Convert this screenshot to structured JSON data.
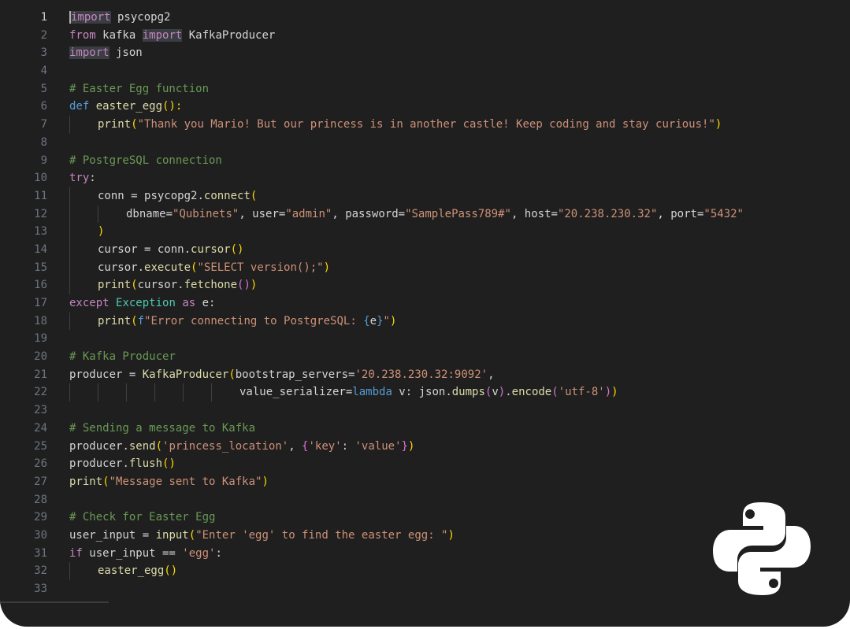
{
  "editor": {
    "active_line": 1,
    "lines": [
      {
        "n": "1",
        "tokens": [
          {
            "t": "import",
            "c": "kw",
            "hl": true
          },
          {
            "t": " psycopg2",
            "c": "txt"
          }
        ]
      },
      {
        "n": "2",
        "tokens": [
          {
            "t": "from",
            "c": "kw"
          },
          {
            "t": " kafka ",
            "c": "txt"
          },
          {
            "t": "import",
            "c": "kw",
            "hl": true
          },
          {
            "t": " KafkaProducer",
            "c": "txt"
          }
        ]
      },
      {
        "n": "3",
        "tokens": [
          {
            "t": "import",
            "c": "kw",
            "hl": true
          },
          {
            "t": " json",
            "c": "txt"
          }
        ]
      },
      {
        "n": "4",
        "tokens": []
      },
      {
        "n": "5",
        "tokens": [
          {
            "t": "# Easter Egg function",
            "c": "cmt"
          }
        ]
      },
      {
        "n": "6",
        "tokens": [
          {
            "t": "def",
            "c": "def"
          },
          {
            "t": " ",
            "c": "txt"
          },
          {
            "t": "easter_egg",
            "c": "fn"
          },
          {
            "t": "():",
            "c": "paren"
          }
        ]
      },
      {
        "n": "7",
        "indent": 1,
        "tokens": [
          {
            "t": "print",
            "c": "fn"
          },
          {
            "t": "(",
            "c": "paren"
          },
          {
            "t": "\"Thank you Mario! But our princess is in another castle! Keep coding and stay curious!\"",
            "c": "str"
          },
          {
            "t": ")",
            "c": "paren"
          }
        ]
      },
      {
        "n": "8",
        "tokens": []
      },
      {
        "n": "9",
        "tokens": [
          {
            "t": "# PostgreSQL connection",
            "c": "cmt"
          }
        ]
      },
      {
        "n": "10",
        "tokens": [
          {
            "t": "try",
            "c": "kw"
          },
          {
            "t": ":",
            "c": "txt"
          }
        ]
      },
      {
        "n": "11",
        "indent": 1,
        "tokens": [
          {
            "t": "conn",
            "c": "txt"
          },
          {
            "t": " = ",
            "c": "txt"
          },
          {
            "t": "psycopg2",
            "c": "txt"
          },
          {
            "t": ".",
            "c": "txt"
          },
          {
            "t": "connect",
            "c": "fn"
          },
          {
            "t": "(",
            "c": "paren"
          }
        ]
      },
      {
        "n": "12",
        "indent": 2,
        "tokens": [
          {
            "t": "dbname",
            "c": "txt"
          },
          {
            "t": "=",
            "c": "txt"
          },
          {
            "t": "\"Qubinets\"",
            "c": "str"
          },
          {
            "t": ", ",
            "c": "txt"
          },
          {
            "t": "user",
            "c": "txt"
          },
          {
            "t": "=",
            "c": "txt"
          },
          {
            "t": "\"admin\"",
            "c": "str"
          },
          {
            "t": ", ",
            "c": "txt"
          },
          {
            "t": "password",
            "c": "txt"
          },
          {
            "t": "=",
            "c": "txt"
          },
          {
            "t": "\"SamplePass789#\"",
            "c": "str"
          },
          {
            "t": ", ",
            "c": "txt"
          },
          {
            "t": "host",
            "c": "txt"
          },
          {
            "t": "=",
            "c": "txt"
          },
          {
            "t": "\"20.238.230.32\"",
            "c": "str"
          },
          {
            "t": ", ",
            "c": "txt"
          },
          {
            "t": "port",
            "c": "txt"
          },
          {
            "t": "=",
            "c": "txt"
          },
          {
            "t": "\"5432\"",
            "c": "str"
          }
        ]
      },
      {
        "n": "13",
        "indent": 1,
        "tokens": [
          {
            "t": ")",
            "c": "paren"
          }
        ]
      },
      {
        "n": "14",
        "indent": 1,
        "tokens": [
          {
            "t": "cursor",
            "c": "txt"
          },
          {
            "t": " = ",
            "c": "txt"
          },
          {
            "t": "conn",
            "c": "txt"
          },
          {
            "t": ".",
            "c": "txt"
          },
          {
            "t": "cursor",
            "c": "fn"
          },
          {
            "t": "()",
            "c": "paren"
          }
        ]
      },
      {
        "n": "15",
        "indent": 1,
        "tokens": [
          {
            "t": "cursor",
            "c": "txt"
          },
          {
            "t": ".",
            "c": "txt"
          },
          {
            "t": "execute",
            "c": "fn"
          },
          {
            "t": "(",
            "c": "paren"
          },
          {
            "t": "\"SELECT version();\"",
            "c": "str"
          },
          {
            "t": ")",
            "c": "paren"
          }
        ]
      },
      {
        "n": "16",
        "indent": 1,
        "tokens": [
          {
            "t": "print",
            "c": "fn"
          },
          {
            "t": "(",
            "c": "paren"
          },
          {
            "t": "cursor",
            "c": "txt"
          },
          {
            "t": ".",
            "c": "txt"
          },
          {
            "t": "fetchone",
            "c": "fn"
          },
          {
            "t": "()",
            "c": "paren2"
          },
          {
            "t": ")",
            "c": "paren"
          }
        ]
      },
      {
        "n": "17",
        "tokens": [
          {
            "t": "except",
            "c": "kw"
          },
          {
            "t": " ",
            "c": "txt"
          },
          {
            "t": "Exception",
            "c": "cls"
          },
          {
            "t": " ",
            "c": "txt"
          },
          {
            "t": "as",
            "c": "kw"
          },
          {
            "t": " e:",
            "c": "txt"
          }
        ]
      },
      {
        "n": "18",
        "indent": 1,
        "tokens": [
          {
            "t": "print",
            "c": "fn"
          },
          {
            "t": "(",
            "c": "paren"
          },
          {
            "t": "f",
            "c": "def"
          },
          {
            "t": "\"Error connecting to PostgreSQL: ",
            "c": "str"
          },
          {
            "t": "{",
            "c": "def"
          },
          {
            "t": "e",
            "c": "txt"
          },
          {
            "t": "}",
            "c": "def"
          },
          {
            "t": "\"",
            "c": "str"
          },
          {
            "t": ")",
            "c": "paren"
          }
        ]
      },
      {
        "n": "19",
        "tokens": []
      },
      {
        "n": "20",
        "tokens": [
          {
            "t": "# Kafka Producer",
            "c": "cmt"
          }
        ]
      },
      {
        "n": "21",
        "tokens": [
          {
            "t": "producer",
            "c": "txt"
          },
          {
            "t": " = ",
            "c": "txt"
          },
          {
            "t": "KafkaProducer",
            "c": "fn"
          },
          {
            "t": "(",
            "c": "paren"
          },
          {
            "t": "bootstrap_servers",
            "c": "txt"
          },
          {
            "t": "=",
            "c": "txt"
          },
          {
            "t": "'20.238.230.32:9092'",
            "c": "str"
          },
          {
            "t": ",",
            "c": "txt"
          }
        ]
      },
      {
        "n": "22",
        "indent": 6,
        "tokens": [
          {
            "t": "value_serializer",
            "c": "txt"
          },
          {
            "t": "=",
            "c": "txt"
          },
          {
            "t": "lambda",
            "c": "def"
          },
          {
            "t": " v: ",
            "c": "txt"
          },
          {
            "t": "json",
            "c": "txt"
          },
          {
            "t": ".",
            "c": "txt"
          },
          {
            "t": "dumps",
            "c": "fn"
          },
          {
            "t": "(",
            "c": "paren2"
          },
          {
            "t": "v",
            "c": "txt"
          },
          {
            "t": ")",
            "c": "paren2"
          },
          {
            "t": ".",
            "c": "txt"
          },
          {
            "t": "encode",
            "c": "fn"
          },
          {
            "t": "(",
            "c": "paren2"
          },
          {
            "t": "'utf-8'",
            "c": "str"
          },
          {
            "t": ")",
            "c": "paren2"
          },
          {
            "t": ")",
            "c": "paren"
          }
        ]
      },
      {
        "n": "23",
        "tokens": []
      },
      {
        "n": "24",
        "tokens": [
          {
            "t": "# Sending a message to Kafka",
            "c": "cmt"
          }
        ]
      },
      {
        "n": "25",
        "tokens": [
          {
            "t": "producer",
            "c": "txt"
          },
          {
            "t": ".",
            "c": "txt"
          },
          {
            "t": "send",
            "c": "fn"
          },
          {
            "t": "(",
            "c": "paren"
          },
          {
            "t": "'princess_location'",
            "c": "str"
          },
          {
            "t": ", ",
            "c": "txt"
          },
          {
            "t": "{",
            "c": "paren2"
          },
          {
            "t": "'key'",
            "c": "str"
          },
          {
            "t": ": ",
            "c": "txt"
          },
          {
            "t": "'value'",
            "c": "str"
          },
          {
            "t": "}",
            "c": "paren2"
          },
          {
            "t": ")",
            "c": "paren"
          }
        ]
      },
      {
        "n": "26",
        "tokens": [
          {
            "t": "producer",
            "c": "txt"
          },
          {
            "t": ".",
            "c": "txt"
          },
          {
            "t": "flush",
            "c": "fn"
          },
          {
            "t": "()",
            "c": "paren"
          }
        ]
      },
      {
        "n": "27",
        "tokens": [
          {
            "t": "print",
            "c": "fn"
          },
          {
            "t": "(",
            "c": "paren"
          },
          {
            "t": "\"Message sent to Kafka\"",
            "c": "str"
          },
          {
            "t": ")",
            "c": "paren"
          }
        ]
      },
      {
        "n": "28",
        "tokens": []
      },
      {
        "n": "29",
        "tokens": [
          {
            "t": "# Check for Easter Egg",
            "c": "cmt"
          }
        ]
      },
      {
        "n": "30",
        "tokens": [
          {
            "t": "user_input",
            "c": "txt"
          },
          {
            "t": " = ",
            "c": "txt"
          },
          {
            "t": "input",
            "c": "fn"
          },
          {
            "t": "(",
            "c": "paren"
          },
          {
            "t": "\"Enter 'egg' to find the easter egg: \"",
            "c": "str"
          },
          {
            "t": ")",
            "c": "paren"
          }
        ]
      },
      {
        "n": "31",
        "tokens": [
          {
            "t": "if",
            "c": "kw"
          },
          {
            "t": " user_input == ",
            "c": "txt"
          },
          {
            "t": "'egg'",
            "c": "str"
          },
          {
            "t": ":",
            "c": "txt"
          }
        ]
      },
      {
        "n": "32",
        "indent": 1,
        "tokens": [
          {
            "t": "easter_egg",
            "c": "fn"
          },
          {
            "t": "()",
            "c": "paren"
          }
        ]
      },
      {
        "n": "33",
        "tokens": []
      }
    ]
  },
  "logo": {
    "icon": "python-logo-icon",
    "color": "#ffffff"
  },
  "colors": {
    "background": "#1f1f1f",
    "outer": "#ffffff"
  }
}
